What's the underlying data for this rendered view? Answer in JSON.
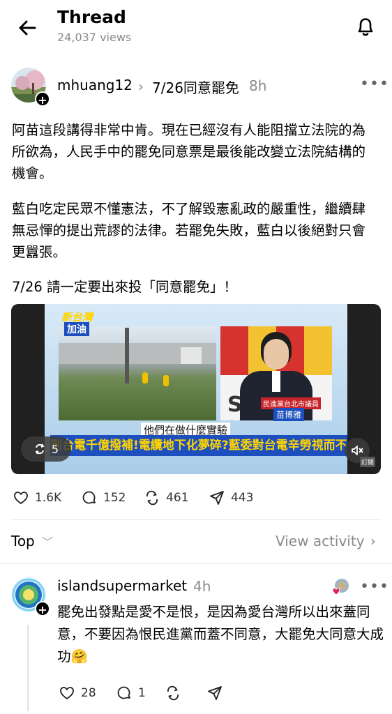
{
  "header": {
    "title": "Thread",
    "views": "24,037 views"
  },
  "post": {
    "author": "mhuang12",
    "topic": "7/26同意罷免",
    "time": "8h",
    "paragraphs": [
      "阿苗這段講得非常中肯。現在已經沒有人能阻擋立法院的為所欲為，人民手中的罷免同意票是最後能改變立法院結構的機會。",
      "藍白吃定民眾不懂憲法，不了解毀憲亂政的嚴重性，繼續肆無忌憚的提出荒謬的法律。若罷免失敗，藍白以後絕對只會更囂張。",
      "7/26 請一定要出來投「同意罷免」！"
    ],
    "video": {
      "logo_line1": "新台灣",
      "logo_line2": "加油",
      "subtitle": "他們在做什麼實驗",
      "ticker": "刪台電千億撥補!電纜地下化夢碎?藍委對台電辛勞視而不見?",
      "name_title": "民進黨台北市議員",
      "name": "苗博雅",
      "backdrop_text": "SET NET",
      "repost_count": "5",
      "brand_corner": "訂閱"
    },
    "actions": {
      "likes": "1.6K",
      "comments": "152",
      "reposts": "461",
      "shares": "443"
    }
  },
  "sort": {
    "label": "Top",
    "view_activity": "View activity"
  },
  "reply": {
    "author": "islandsupermarket",
    "time": "4h",
    "text": "罷免出發點是愛不是恨，是因為愛台灣所以出來蓋同意，不要因為恨民進黨而蓋不同意，大罷免大同意大成功🤗",
    "likes": "28",
    "comments": "1"
  },
  "colors": {
    "accent_heart": "#e0245e",
    "muted": "#8a8a8a",
    "ticker_blue": "#1d4fbf",
    "ticker_yellow": "#ffd400"
  },
  "icons": [
    "back-arrow-icon",
    "bell-icon",
    "more-icon",
    "heart-icon",
    "comment-icon",
    "repost-icon",
    "share-icon",
    "mute-icon",
    "chevron-down-icon",
    "chevron-right-icon"
  ]
}
